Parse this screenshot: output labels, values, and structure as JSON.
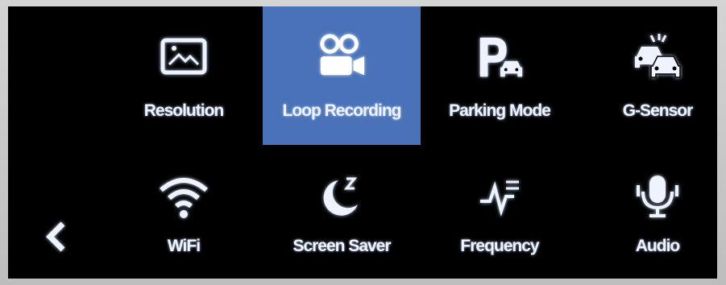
{
  "menu": {
    "items": [
      {
        "label": "Resolution",
        "icon": "image-icon"
      },
      {
        "label": "Loop Recording",
        "icon": "video-camera-icon",
        "selected": true
      },
      {
        "label": "Parking Mode",
        "icon": "parking-car-icon"
      },
      {
        "label": "G-Sensor",
        "icon": "car-collision-icon"
      },
      {
        "label": "WiFi",
        "icon": "wifi-icon"
      },
      {
        "label": "Screen Saver",
        "icon": "moon-sleep-icon"
      },
      {
        "label": "Frequency",
        "icon": "frequency-wave-icon"
      },
      {
        "label": "Audio",
        "icon": "microphone-icon"
      }
    ]
  },
  "colors": {
    "selected_bg": "#4a72b8",
    "screen_bg": "#000000",
    "text": "#eef3ff"
  }
}
